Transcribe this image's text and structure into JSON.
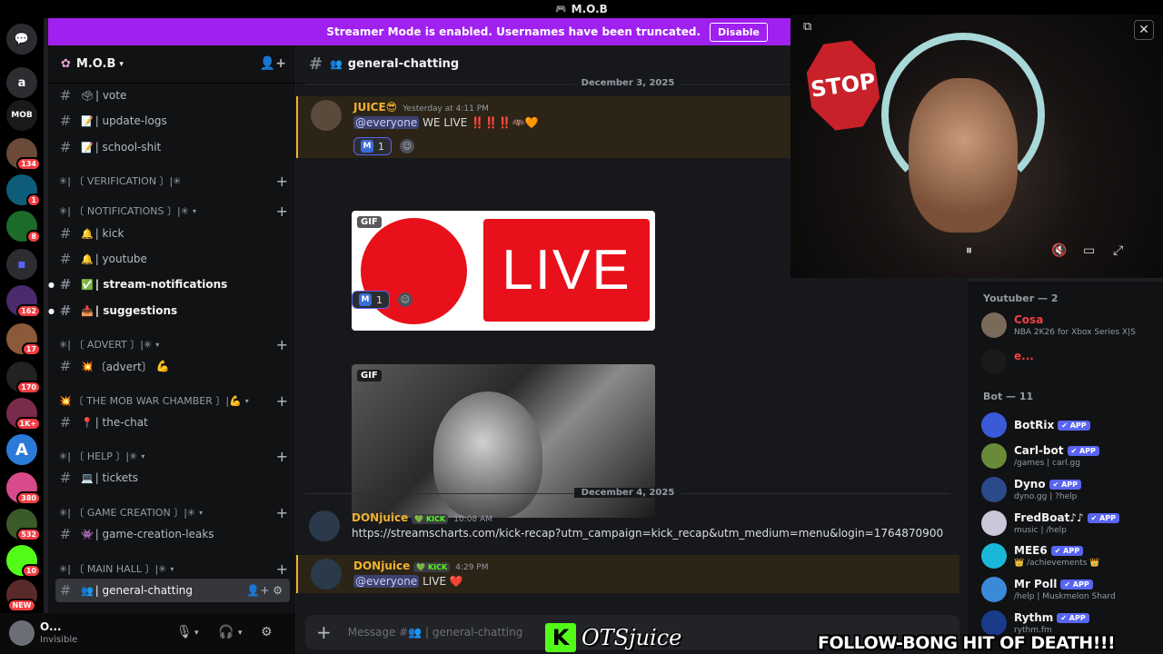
{
  "window": {
    "title": "M.O.B"
  },
  "streamer_bar": {
    "text": "Streamer Mode is enabled. Usernames have been truncated.",
    "disable_label": "Disable"
  },
  "rail": {
    "items": [
      {
        "label": "a",
        "badge": ""
      },
      {
        "label": "MOB",
        "badge": ""
      },
      {
        "label": "",
        "badge": "134"
      },
      {
        "label": "",
        "badge": "1"
      },
      {
        "label": "",
        "badge": "8"
      },
      {
        "label": "",
        "badge": "162"
      },
      {
        "label": "",
        "badge": "17"
      },
      {
        "label": "",
        "badge": "170"
      },
      {
        "label": "",
        "badge": "1K+"
      },
      {
        "label": "A",
        "badge": ""
      },
      {
        "label": "",
        "badge": "380"
      },
      {
        "label": "",
        "badge": "532"
      },
      {
        "label": "",
        "badge": "10"
      },
      {
        "label": "",
        "badge": "NEW"
      }
    ]
  },
  "server": {
    "name": "M.O.B"
  },
  "channels": {
    "vote": "| vote",
    "update_logs": "| update-logs",
    "school": "| school-shit",
    "cat_verification": "✳| 〔 VERIFICATION 〕|✳",
    "cat_notifications": "✳| 〔 NOTIFICATIONS 〕|✳",
    "kick": "| kick",
    "youtube": "| youtube",
    "stream_notifications": "| stream-notifications",
    "suggestions": "| suggestions",
    "cat_advert": "✳| 〔 ADVERT 〕|✳",
    "advert": "〔advert〕",
    "cat_mobwar": "〔 THE MOB WAR CHAMBER 〕|",
    "the_chat": "| the-chat",
    "cat_help": "✳| 〔 HELP 〕|✳",
    "tickets": "| tickets",
    "cat_gamecreation": "✳| 〔 GAME CREATION 〕|✳",
    "game_creation_leaks": "| game-creation-leaks",
    "cat_mainhall": "✳| 〔 MAIN HALL 〕|✳",
    "general_chatting": "| general-chatting"
  },
  "user": {
    "name": "O...",
    "status": "Invisible"
  },
  "chat": {
    "channel": "general-chatting",
    "date1": "December 3, 2025",
    "msg1": {
      "author": "JUICE😎",
      "time": "Yesterday at 4:11 PM",
      "mention": "@everyone",
      "text": "WE LIVE ‼️‼️‼️🦇🧡"
    },
    "reaction_count": "1",
    "gif_label": "GIF",
    "live_text": "LIVE",
    "date2": "December 4, 2025",
    "msg2": {
      "author": "DONjuice",
      "tag": "KICK",
      "time": "10:08 AM",
      "link": "https://streamscharts.com/kick-recap?utm_campaign=kick_recap&utm_medium=menu&login=1764870900"
    },
    "msg3": {
      "author": "DONjuice",
      "tag": "KICK",
      "time": "4:29 PM",
      "mention": "@everyone",
      "text": "LIVE ❤️"
    },
    "composer_placeholder": "Message #👥 | general-chatting"
  },
  "members": {
    "youtuber_heading": "Youtuber — 2",
    "youtubers": [
      {
        "name": "Cosa",
        "activity": "NBA 2K26 for Xbox Series X|S"
      },
      {
        "name": "e...",
        "activity": ""
      }
    ],
    "bot_heading": "Bot — 11",
    "bots": [
      {
        "name": "BotRix",
        "tag": "✔ APP",
        "activity": ""
      },
      {
        "name": "Carl-bot",
        "tag": "✔ APP",
        "activity": "/games | carl.gg"
      },
      {
        "name": "Dyno",
        "tag": "✔ APP",
        "activity": "dyno.gg | ?help"
      },
      {
        "name": "FredBoat♪♪",
        "tag": "✔ APP",
        "activity": "music | /help"
      },
      {
        "name": "MEE6",
        "tag": "✔ APP",
        "activity": "👑 /achievements 👑"
      },
      {
        "name": "Mr Poll",
        "tag": "✔ APP",
        "activity": "/help | Muskmelon Shard"
      },
      {
        "name": "Rythm",
        "tag": "✔ APP",
        "activity": "rythm.fm"
      }
    ]
  },
  "webcam": {
    "sign_text": "STOP"
  },
  "overlay": {
    "logo_letter": "K",
    "logo_text": "OTSjuice",
    "follow_text": "FOLLOW-BONG HIT OF DEATH!!!"
  },
  "colors": {
    "streamer_bar": "#a020f0",
    "accent": "#5865f2",
    "kick_green": "#53fc18",
    "live_red": "#e8101a",
    "highlight": "#f0b232"
  }
}
